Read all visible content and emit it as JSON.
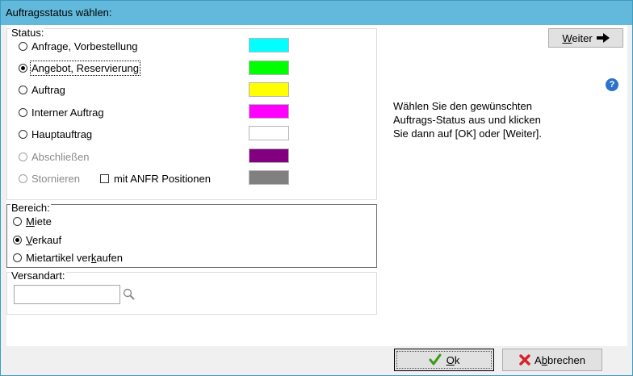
{
  "window": {
    "title": "Auftragsstatus wählen:"
  },
  "status": {
    "legend": "Status:",
    "options": [
      {
        "label": "Anfrage, Vorbestellung",
        "color": "#00ffff",
        "selected": false,
        "disabled": false
      },
      {
        "label": "Angebot, Reservierung",
        "color": "#00ff00",
        "selected": true,
        "disabled": false
      },
      {
        "label": "Auftrag",
        "color": "#ffff00",
        "selected": false,
        "disabled": false
      },
      {
        "label": "Interner Auftrag",
        "color": "#ff00ff",
        "selected": false,
        "disabled": false
      },
      {
        "label": "Hauptauftrag",
        "color": "#ffffff",
        "selected": false,
        "disabled": false
      },
      {
        "label": "Abschließen",
        "color": "#800080",
        "selected": false,
        "disabled": true
      },
      {
        "label": "Stornieren",
        "color": "#808080",
        "selected": false,
        "disabled": true
      }
    ],
    "anfr_checkbox_label": "mit ANFR Positionen",
    "anfr_checked": false
  },
  "bereich": {
    "legend": "Bereich:",
    "options": [
      {
        "pre": "",
        "acc": "M",
        "post": "iete",
        "selected": false
      },
      {
        "pre": "",
        "acc": "V",
        "post": "erkauf",
        "selected": true
      },
      {
        "pre": "Mietartikel ver",
        "acc": "k",
        "post": "aufen",
        "selected": false
      }
    ]
  },
  "versandart": {
    "legend": "Versandart:",
    "value": "",
    "search_icon": "magnifier-icon"
  },
  "weiter": {
    "acc": "W",
    "rest": "eiter",
    "icon": "arrow-right-icon"
  },
  "info_text": "Wählen Sie den gewünschten\nAuftrags-Status aus und klicken\nSie dann auf [OK] oder [Weiter].",
  "help": {
    "glyph": "?",
    "icon": "help-icon"
  },
  "buttons": {
    "ok": {
      "acc": "O",
      "rest": "k",
      "icon": "checkmark-icon",
      "icon_color": "#3a9a1a"
    },
    "cancel": {
      "acc": "b",
      "pre": "A",
      "rest": "brechen",
      "icon": "cross-icon",
      "icon_color": "#d8202a"
    }
  }
}
